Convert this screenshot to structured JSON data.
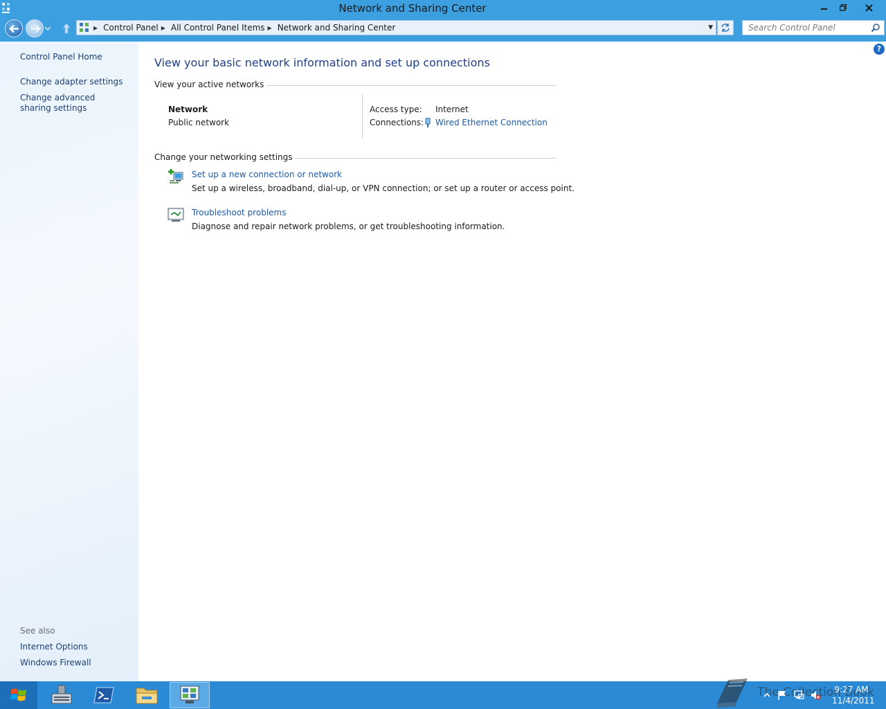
{
  "window": {
    "title": "Network and Sharing Center"
  },
  "address": {
    "crumbs": [
      "Control Panel",
      "All Control Panel Items",
      "Network and Sharing Center"
    ]
  },
  "search": {
    "placeholder": "Search Control Panel"
  },
  "sidebar": {
    "home": "Control Panel Home",
    "items": [
      {
        "label": "Change adapter settings"
      },
      {
        "label": "Change advanced sharing settings"
      }
    ],
    "see_also_heading": "See also",
    "see_also": [
      {
        "label": "Internet Options"
      },
      {
        "label": "Windows Firewall"
      }
    ]
  },
  "main": {
    "title": "View your basic network information and set up connections",
    "active_networks_heading": "View your active networks",
    "network": {
      "name": "Network",
      "type": "Public network",
      "access_type_label": "Access type:",
      "access_type_value": "Internet",
      "connections_label": "Connections:",
      "connections_value": "Wired Ethernet Connection"
    },
    "settings_heading": "Change your networking settings",
    "tasks": [
      {
        "link": "Set up a new connection or network",
        "description": "Set up a wireless, broadband, dial-up, or VPN connection; or set up a router or access point."
      },
      {
        "link": "Troubleshoot problems",
        "description": "Diagnose and repair network problems, or get troubleshooting information."
      }
    ]
  },
  "taskbar": {
    "clock_time": "9:27 AM",
    "clock_date": "11/4/2011",
    "watermark_text": "The Collection Book"
  },
  "colors": {
    "titlebar": "#3c9fe0",
    "taskbar": "#2b8ad6",
    "link": "#1e5aa8",
    "page_title": "#1e3f8a"
  }
}
